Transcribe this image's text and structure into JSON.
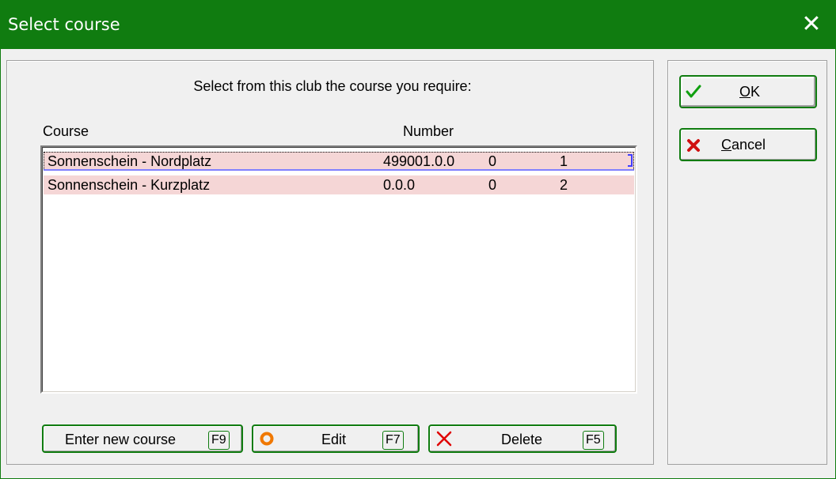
{
  "window": {
    "title": "Select course",
    "close_glyph": "✕"
  },
  "prompt": "Select from this club the course you require:",
  "columns": {
    "course": "Course",
    "number": "Number"
  },
  "rows": [
    {
      "course": "Sonnenschein - Nordplatz",
      "number": "499001.0.0",
      "col3": "0",
      "col4": "1",
      "selected": true
    },
    {
      "course": "Sonnenschein - Kurzplatz",
      "number": "0.0.0",
      "col3": "0",
      "col4": "2",
      "selected": false
    }
  ],
  "buttons": {
    "enter_new": {
      "label": "Enter new course",
      "key": "F9"
    },
    "edit": {
      "label": "Edit",
      "key": "F7",
      "icon": "ring-icon"
    },
    "delete": {
      "label": "Delete",
      "key": "F5",
      "icon": "cross-icon"
    },
    "ok": {
      "label_first": "O",
      "label_rest": "K",
      "icon": "checkmark-icon"
    },
    "cancel": {
      "label_first": "C",
      "label_rest": "ancel",
      "icon": "x-icon"
    }
  },
  "colors": {
    "titlebar": "#107c10",
    "row_bg": "#f5d6d6",
    "accent": "#107c10"
  }
}
